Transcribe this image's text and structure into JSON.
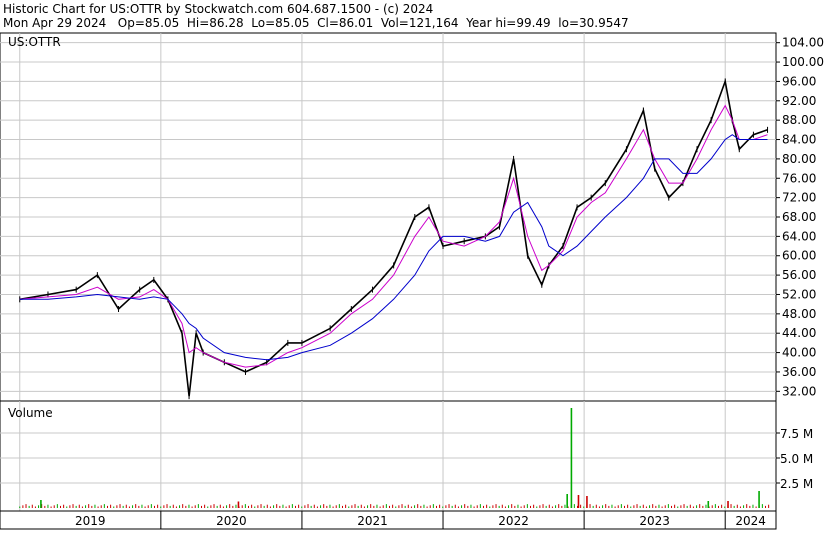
{
  "header": {
    "line1": "Historic Chart for US:OTTR by Stockwatch.com 604.687.1500 - (c) 2024",
    "line2": "Mon Apr 29 2024   Op=85.05  Hi=86.28  Lo=85.05  Cl=86.01  Vol=121,164  Year hi=99.49  lo=30.9547"
  },
  "chart_data": [
    {
      "type": "line",
      "title": "US:OTTR",
      "ylim": [
        30,
        106
      ],
      "y_ticks": [
        "104.00",
        "100.00",
        "96.00",
        "92.00",
        "88.00",
        "84.00",
        "80.00",
        "76.00",
        "72.00",
        "68.00",
        "64.00",
        "60.00",
        "56.00",
        "52.00",
        "48.00",
        "44.00",
        "40.00",
        "36.00",
        "32.00"
      ],
      "x_ticks": [
        "2019",
        "2020",
        "2021",
        "2022",
        "2023",
        "2024"
      ],
      "x": [
        2019.0,
        2019.2,
        2019.4,
        2019.55,
        2019.7,
        2019.85,
        2019.95,
        2020.05,
        2020.15,
        2020.2,
        2020.25,
        2020.3,
        2020.45,
        2020.6,
        2020.75,
        2020.9,
        2021.0,
        2021.2,
        2021.35,
        2021.5,
        2021.65,
        2021.8,
        2021.9,
        2022.0,
        2022.15,
        2022.3,
        2022.4,
        2022.5,
        2022.6,
        2022.7,
        2022.75,
        2022.85,
        2022.95,
        2023.05,
        2023.15,
        2023.3,
        2023.42,
        2023.5,
        2023.6,
        2023.7,
        2023.8,
        2023.9,
        2024.0,
        2024.05,
        2024.1,
        2024.2,
        2024.3
      ],
      "series": [
        {
          "values": [
            51,
            52,
            53,
            56,
            49,
            53,
            55,
            51,
            44,
            31,
            44,
            40,
            38,
            36,
            38,
            42,
            42,
            45,
            49,
            53,
            58,
            68,
            70,
            62,
            63,
            64,
            66,
            80,
            60,
            54,
            58,
            62,
            70,
            72,
            75,
            82,
            90,
            78,
            72,
            75,
            82,
            88,
            96,
            88,
            82,
            85,
            86
          ],
          "color": "#000000"
        },
        {
          "values": [
            51,
            51.5,
            52,
            53.5,
            51,
            51.5,
            53,
            51,
            46,
            40,
            41,
            40,
            38,
            37,
            37.5,
            40,
            41,
            44,
            48,
            51,
            56,
            64,
            68,
            63,
            62,
            64,
            67,
            76,
            64,
            57,
            58,
            61,
            68,
            71,
            73,
            80,
            86,
            80,
            75,
            75,
            80,
            86,
            91,
            88,
            84,
            84,
            85
          ],
          "color": "#cc00cc"
        },
        {
          "values": [
            51,
            51,
            51.5,
            52,
            51.5,
            51,
            51.5,
            51,
            48,
            46,
            45,
            43,
            40,
            39,
            38.5,
            39,
            40,
            41.5,
            44,
            47,
            51,
            56,
            61,
            64,
            64,
            63,
            64,
            69,
            71,
            66,
            62,
            60,
            62,
            65,
            68,
            72,
            76,
            80,
            80,
            77,
            77,
            80,
            84,
            85,
            84,
            84,
            84
          ],
          "color": "#0000cc"
        }
      ]
    },
    {
      "type": "bar",
      "title": "Volume",
      "ylim": [
        0,
        10000000
      ],
      "y_ticks": [
        "7.5 M",
        "5.0 M",
        "2.5 M"
      ],
      "x_ticks": [
        "2019",
        "2020",
        "2021",
        "2022",
        "2023",
        "2024"
      ],
      "spikes": [
        {
          "x": 2019.15,
          "value": 800000,
          "color": "#00aa00"
        },
        {
          "x": 2020.55,
          "value": 650000,
          "color": "#cc0000"
        },
        {
          "x": 2022.88,
          "value": 1400000,
          "color": "#00aa00"
        },
        {
          "x": 2022.91,
          "value": 10000000,
          "color": "#00aa00"
        },
        {
          "x": 2022.96,
          "value": 1300000,
          "color": "#cc0000"
        },
        {
          "x": 2023.02,
          "value": 1200000,
          "color": "#cc0000"
        },
        {
          "x": 2023.88,
          "value": 700000,
          "color": "#00aa00"
        },
        {
          "x": 2024.02,
          "value": 700000,
          "color": "#cc0000"
        },
        {
          "x": 2024.24,
          "value": 1700000,
          "color": "#00aa00"
        }
      ]
    }
  ]
}
